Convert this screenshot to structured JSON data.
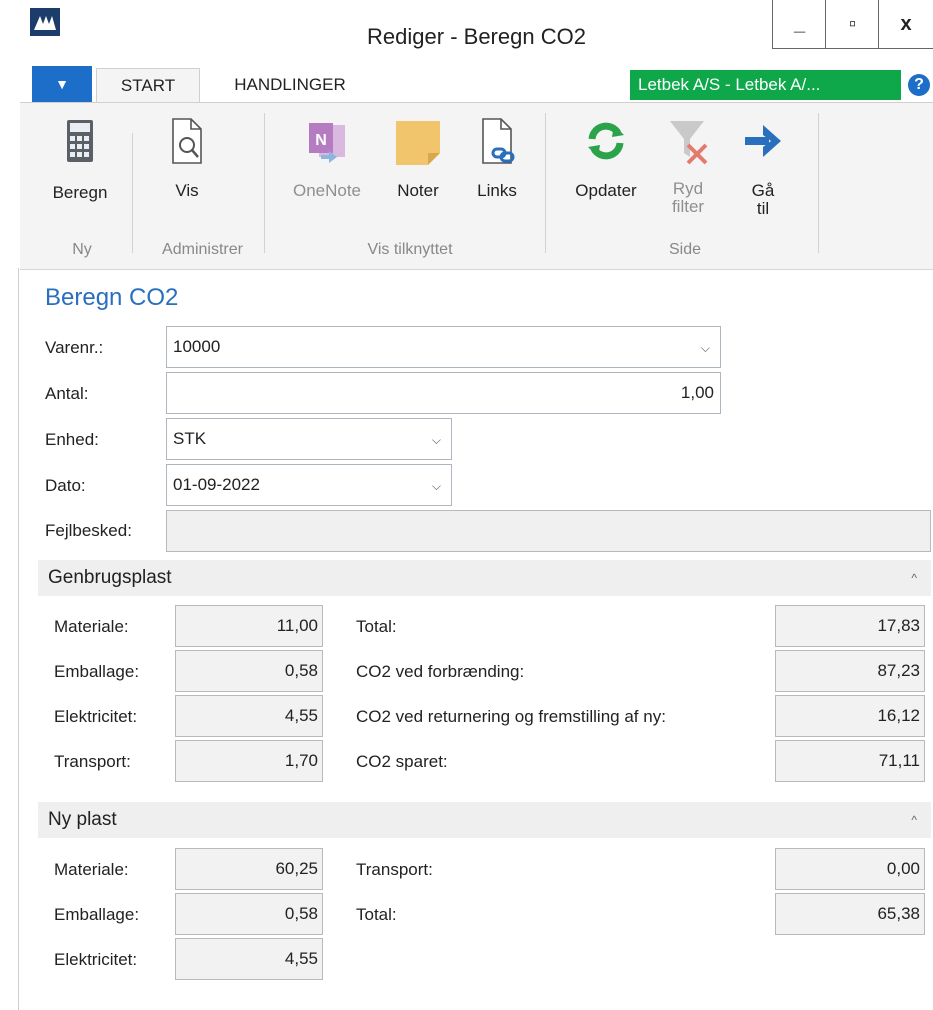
{
  "window": {
    "title": "Rediger - Beregn CO2",
    "minimize": "_",
    "maximize": "▫",
    "close": "x"
  },
  "tabs": {
    "start": "START",
    "handlinger": "HANDLINGER",
    "company": "Letbek A/S - Letbek A/...",
    "help": "?"
  },
  "ribbon": {
    "beregn": "Beregn",
    "vis": "Vis",
    "onenote": "OneNote",
    "noter": "Noter",
    "links": "Links",
    "opdater": "Opdater",
    "ryd_filter_1": "Ryd",
    "ryd_filter_2": "filter",
    "gaa_til_1": "Gå",
    "gaa_til_2": "til",
    "groups": {
      "ny": "Ny",
      "administrer": "Administrer",
      "vis_tilknyttet": "Vis tilknyttet",
      "side": "Side"
    }
  },
  "page_title": "Beregn CO2",
  "form": {
    "varenr_label": "Varenr.:",
    "varenr_value": "10000",
    "antal_label": "Antal:",
    "antal_value": "1,00",
    "enhed_label": "Enhed:",
    "enhed_value": "STK",
    "dato_label": "Dato:",
    "dato_value": "01-09-2022",
    "fejl_label": "Fejlbesked:",
    "fejl_value": ""
  },
  "genbrug": {
    "title": "Genbrugsplast",
    "materiale_label": "Materiale:",
    "materiale": "11,00",
    "emballage_label": "Emballage:",
    "emballage": "0,58",
    "el_label": "Elektricitet:",
    "el": "4,55",
    "transport_label": "Transport:",
    "transport": "1,70",
    "total_label": "Total:",
    "total": "17,83",
    "forbr_label": "CO2 ved forbrænding:",
    "forbr": "87,23",
    "retur_label": "CO2 ved returnering og fremstilling af ny:",
    "retur": "16,12",
    "sparet_label": "CO2 sparet:",
    "sparet": "71,11"
  },
  "ny": {
    "title": "Ny plast",
    "materiale_label": "Materiale:",
    "materiale": "60,25",
    "emballage_label": "Emballage:",
    "emballage": "0,58",
    "el_label": "Elektricitet:",
    "el": "4,55",
    "transport_label": "Transport:",
    "transport": "0,00",
    "total_label": "Total:",
    "total": "65,38"
  },
  "icons": [
    "app-logo-icon",
    "calculator-icon",
    "document-search-icon",
    "onenote-icon",
    "note-icon",
    "link-document-icon",
    "refresh-icon",
    "clear-filter-icon",
    "arrow-right-icon",
    "chevron-down-icon",
    "chevron-up-icon"
  ],
  "colors": {
    "accent": "#1d6ec9",
    "company_badge": "#0ea84b",
    "title_blue": "#2a6fbd"
  }
}
